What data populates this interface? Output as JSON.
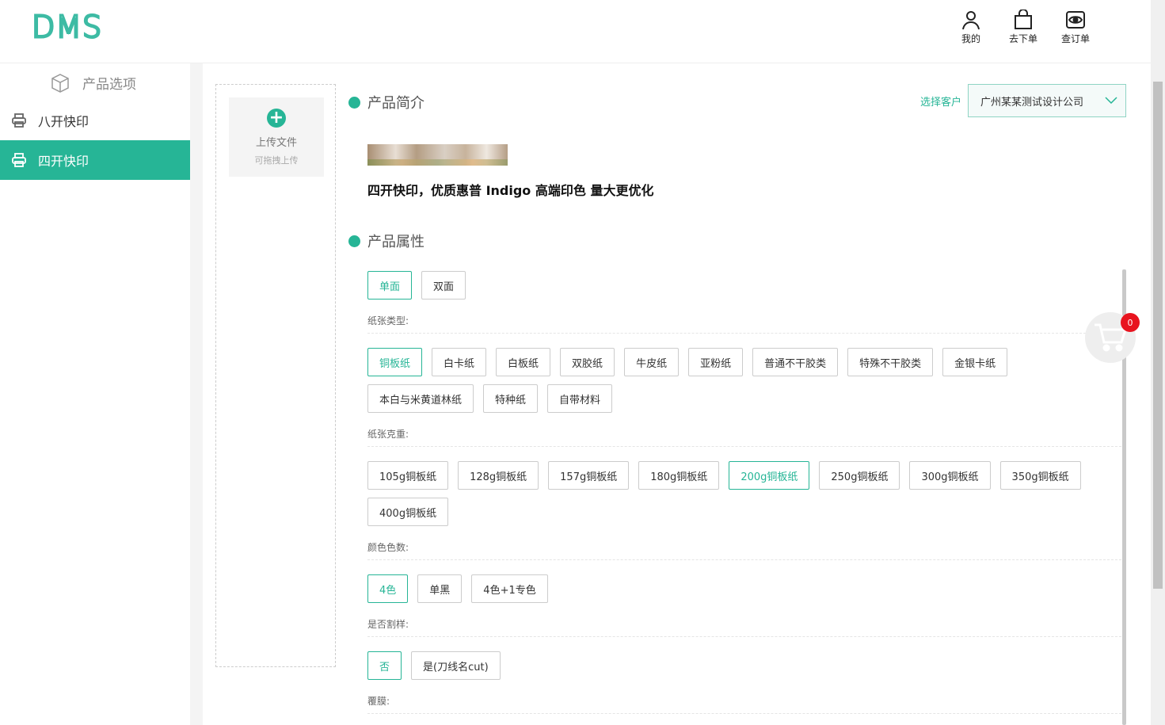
{
  "header": {
    "logo": "DMS",
    "actions": [
      {
        "icon": "user-icon",
        "label": "我的"
      },
      {
        "icon": "bag-icon",
        "label": "去下单"
      },
      {
        "icon": "eye-icon",
        "label": "查订单"
      }
    ]
  },
  "sidebar": {
    "title": "产品选项",
    "items": [
      {
        "label": "八开快印",
        "active": false
      },
      {
        "label": "四开快印",
        "active": true
      }
    ]
  },
  "upload": {
    "label": "上传文件",
    "sub": "可拖拽上传"
  },
  "intro": {
    "heading": "产品简介",
    "description": "四开快印，优质惠普 Indigo 高端印色 量大更优化"
  },
  "customer": {
    "label": "选择客户",
    "value": "广州某某测试设计公司"
  },
  "attributes": {
    "heading": "产品属性",
    "sides": [
      {
        "label": "单面",
        "selected": true
      },
      {
        "label": "双面",
        "selected": false
      }
    ],
    "paper_type_label": "纸张类型:",
    "paper_types": [
      {
        "label": "铜板纸",
        "selected": true
      },
      {
        "label": "白卡纸",
        "selected": false
      },
      {
        "label": "白板纸",
        "selected": false
      },
      {
        "label": "双胶纸",
        "selected": false
      },
      {
        "label": "牛皮纸",
        "selected": false
      },
      {
        "label": "亚粉纸",
        "selected": false
      },
      {
        "label": "普通不干胶类",
        "selected": false
      },
      {
        "label": "特殊不干胶类",
        "selected": false
      },
      {
        "label": "金银卡纸",
        "selected": false
      },
      {
        "label": "本白与米黄道林纸",
        "selected": false
      },
      {
        "label": "特种纸",
        "selected": false
      },
      {
        "label": "自带材料",
        "selected": false
      }
    ],
    "weight_label": "纸张克重:",
    "weights": [
      {
        "label": "105g铜板纸",
        "selected": false
      },
      {
        "label": "128g铜板纸",
        "selected": false
      },
      {
        "label": "157g铜板纸",
        "selected": false
      },
      {
        "label": "180g铜板纸",
        "selected": false
      },
      {
        "label": "200g铜板纸",
        "selected": true
      },
      {
        "label": "250g铜板纸",
        "selected": false
      },
      {
        "label": "300g铜板纸",
        "selected": false
      },
      {
        "label": "350g铜板纸",
        "selected": false
      },
      {
        "label": "400g铜板纸",
        "selected": false
      }
    ],
    "color_label": "颜色色数:",
    "colors": [
      {
        "label": "4色",
        "selected": true
      },
      {
        "label": "单黑",
        "selected": false
      },
      {
        "label": "4色+1专色",
        "selected": false
      }
    ],
    "cut_label": "是否割样:",
    "cuts": [
      {
        "label": "否",
        "selected": true
      },
      {
        "label": "是(刀线名cut)",
        "selected": false
      }
    ],
    "film_label": "覆膜:"
  },
  "cart": {
    "count": "0"
  },
  "colors": {
    "accent": "#26b596",
    "badge": "#e8141f"
  }
}
